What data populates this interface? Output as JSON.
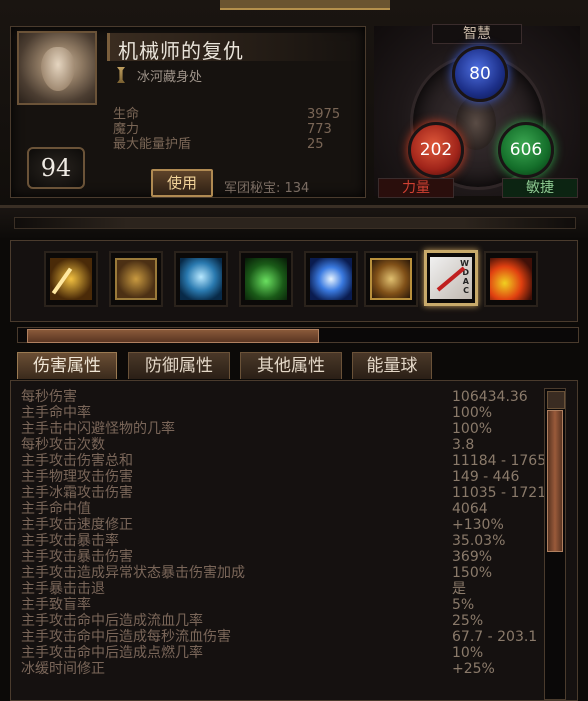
{
  "character": {
    "name": "机械师的复仇",
    "location": "冰河藏身处",
    "level": "94",
    "stats": [
      {
        "label": "生命",
        "value": "3975"
      },
      {
        "label": "魔力",
        "value": "773"
      },
      {
        "label": "最大能量护盾",
        "value": "25"
      }
    ],
    "use_button": "使用",
    "legion_treasure": "军团秘宝: 134"
  },
  "attributes": {
    "intelligence": {
      "label": "智慧",
      "value": "80",
      "color": "#3d5fd8"
    },
    "strength": {
      "label": "力量",
      "value": "202",
      "color": "#d04025"
    },
    "dexterity": {
      "label": "敏捷",
      "value": "606",
      "color": "#30a048"
    }
  },
  "skills": [
    {
      "icon": "golden-sword-icon"
    },
    {
      "icon": "spinning-blades-icon"
    },
    {
      "icon": "ice-lightning-icon"
    },
    {
      "icon": "green-herald-icon"
    },
    {
      "icon": "frost-orb-icon"
    },
    {
      "icon": "fist-icon"
    },
    {
      "icon": "arrow-rune-icon",
      "selected": true,
      "tags": [
        "W",
        "D",
        "A",
        "C"
      ]
    },
    {
      "icon": "flame-warrior-icon"
    }
  ],
  "tabs": [
    {
      "label": "伤害属性",
      "active": true
    },
    {
      "label": "防御属性",
      "active": false
    },
    {
      "label": "其他属性",
      "active": false
    },
    {
      "label": "能量球",
      "active": false
    }
  ],
  "damage_stats": [
    {
      "key": "每秒伤害",
      "value": "106434.36"
    },
    {
      "key": "主手命中率",
      "value": "100%"
    },
    {
      "key": "主手击中闪避怪物的几率",
      "value": "100%"
    },
    {
      "key": "每秒攻击次数",
      "value": "3.8"
    },
    {
      "key": "主手攻击伤害总和",
      "value": "11184 - 17657"
    },
    {
      "key": "主手物理攻击伤害",
      "value": "149 - 446"
    },
    {
      "key": "主手冰霜攻击伤害",
      "value": "11035 - 17211"
    },
    {
      "key": "主手命中值",
      "value": "4064"
    },
    {
      "key": "主手攻击速度修正",
      "value": "+130%"
    },
    {
      "key": "主手攻击暴击率",
      "value": "35.03%"
    },
    {
      "key": "主手攻击暴击伤害",
      "value": "369%"
    },
    {
      "key": "主手攻击造成异常状态暴击伤害加成",
      "value": "150%"
    },
    {
      "key": "主手暴击击退",
      "value": "是"
    },
    {
      "key": "主手致盲率",
      "value": "5%"
    },
    {
      "key": "主手攻击命中后造成流血几率",
      "value": "25%"
    },
    {
      "key": "主手攻击命中后造成每秒流血伤害",
      "value": "67.7 - 203.1"
    },
    {
      "key": "主手攻击命中后造成点燃几率",
      "value": "10%"
    },
    {
      "key": "冰缓时间修正",
      "value": "+25%"
    }
  ]
}
